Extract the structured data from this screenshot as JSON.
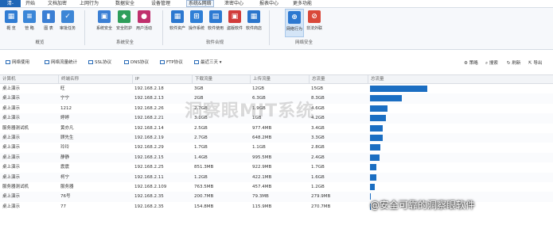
{
  "menubar": {
    "first": "清-",
    "items": [
      "开始",
      "文档加密",
      "上网行为",
      "数据安全",
      "设备管理",
      "系统&网络",
      "泄密中心",
      "报表中心",
      "更多功能"
    ],
    "active_index": 5
  },
  "ribbon": {
    "groups": [
      {
        "title": "概览",
        "buttons": [
          {
            "label": "概 览",
            "icon": "grid-icon",
            "color": "#2f7cd3",
            "glyph": "▦"
          },
          {
            "label": "管 略",
            "icon": "sliders-icon",
            "color": "#3a86d8",
            "glyph": "≡"
          },
          {
            "label": "图 表",
            "icon": "chart-icon",
            "color": "#3b7fd4",
            "glyph": "▮"
          },
          {
            "label": "审批任务",
            "icon": "checklist-icon",
            "color": "#3d86d6",
            "glyph": "✓"
          }
        ]
      },
      {
        "title": "系统安全",
        "buttons": [
          {
            "label": "系统安全",
            "icon": "monitor-shield-icon",
            "color": "#3b7fd4",
            "glyph": "▣"
          },
          {
            "label": "安全防护",
            "icon": "shield-icon",
            "color": "#2e9e5b",
            "glyph": "◆"
          },
          {
            "label": "用户活动",
            "icon": "user-icon",
            "color": "#c0306d",
            "glyph": "●"
          }
        ]
      },
      {
        "title": "软件合规",
        "buttons": [
          {
            "label": "软件资产",
            "icon": "apps-icon",
            "color": "#2c78d0",
            "glyph": "▦"
          },
          {
            "label": "操作系统",
            "icon": "windows-icon",
            "color": "#2f7fd6",
            "glyph": "⊞"
          },
          {
            "label": "软件使用",
            "icon": "software-usage-icon",
            "color": "#2d7ad2",
            "glyph": "▤"
          },
          {
            "label": "盗版软件",
            "icon": "pirate-software-icon",
            "color": "#d13b3b",
            "glyph": "▣"
          },
          {
            "label": "软件商店",
            "icon": "store-icon",
            "color": "#2a75cc",
            "glyph": "▦"
          }
        ]
      },
      {
        "title": "网络安全",
        "buttons": [
          {
            "label": "网络行为",
            "icon": "globe-icon",
            "color": "#2c78d0",
            "glyph": "⊕",
            "selected": true
          },
          {
            "label": "非法外联",
            "icon": "outbound-block-icon",
            "color": "#d9493a",
            "glyph": "⊘"
          }
        ]
      }
    ]
  },
  "toolbar": {
    "tabs": [
      {
        "label": "网络使用",
        "selected": true
      },
      {
        "label": "网络流量统计",
        "selected": false
      },
      {
        "label": "SSL协议",
        "selected": false
      },
      {
        "label": "DNS协议",
        "selected": false
      },
      {
        "label": "FTP协议",
        "selected": false
      }
    ],
    "date_filter": "最近三天",
    "right_buttons": [
      {
        "label": "策略",
        "icon": "policy-icon"
      },
      {
        "label": "搜索",
        "icon": "search-icon"
      },
      {
        "label": "刷新",
        "icon": "refresh-icon"
      },
      {
        "label": "导出",
        "icon": "export-icon"
      }
    ]
  },
  "table": {
    "columns": [
      "计算机",
      "终端名称",
      "IP",
      "下载流量",
      "上传流量",
      "总流量",
      "总流量"
    ],
    "rows": [
      {
        "computer": "桌上演示",
        "terminal": "旺",
        "ip": "192.168.2.18",
        "down": "3GB",
        "up": "12GB",
        "total": "15GB",
        "pct": 1.0
      },
      {
        "computer": "桌上演示",
        "terminal": "宁宁",
        "ip": "192.168.2.13",
        "down": "2GB",
        "up": "6.3GB",
        "total": "8.3GB",
        "pct": 0.553
      },
      {
        "computer": "桌上演示",
        "terminal": "1212",
        "ip": "192.168.2.26",
        "down": "2.7GB",
        "up": "1.9GB",
        "total": "4.6GB",
        "pct": 0.307
      },
      {
        "computer": "桌上演示",
        "terminal": "婷婷",
        "ip": "192.168.2.21",
        "down": "3.1GB",
        "up": "1GB",
        "total": "4.2GB",
        "pct": 0.28
      },
      {
        "computer": "服务器测试机",
        "terminal": "黄亦凡",
        "ip": "192.168.2.14",
        "down": "2.5GB",
        "up": "977.4MB",
        "total": "3.4GB",
        "pct": 0.227
      },
      {
        "computer": "桌上演示",
        "terminal": "顾先生",
        "ip": "192.168.2.19",
        "down": "2.7GB",
        "up": "648.2MB",
        "total": "3.3GB",
        "pct": 0.22
      },
      {
        "computer": "桌上演示",
        "terminal": "玲玲",
        "ip": "192.168.2.29",
        "down": "1.7GB",
        "up": "1.1GB",
        "total": "2.8GB",
        "pct": 0.187
      },
      {
        "computer": "桌上演示",
        "terminal": "静静",
        "ip": "192.168.2.15",
        "down": "1.4GB",
        "up": "995.5MB",
        "total": "2.4GB",
        "pct": 0.16
      },
      {
        "computer": "桌上演示",
        "terminal": "震震",
        "ip": "192.168.2.25",
        "down": "851.3MB",
        "up": "922.9MB",
        "total": "1.7GB",
        "pct": 0.113
      },
      {
        "computer": "桌上演示",
        "terminal": "柯宁",
        "ip": "192.168.2.11",
        "down": "1.2GB",
        "up": "422.1MB",
        "total": "1.6GB",
        "pct": 0.107
      },
      {
        "computer": "服务器测试机",
        "terminal": "服务器",
        "ip": "192.168.2.109",
        "down": "763.5MB",
        "up": "457.4MB",
        "total": "1.2GB",
        "pct": 0.08
      },
      {
        "computer": "桌上演示",
        "terminal": "76号",
        "ip": "192.168.2.35",
        "down": "200.7MB",
        "up": "79.3MB",
        "total": "279.9MB",
        "pct": 0.018
      },
      {
        "computer": "桌上演示",
        "terminal": "77",
        "ip": "192.168.2.35",
        "down": "154.8MB",
        "up": "115.9MB",
        "total": "270.7MB",
        "pct": 0.017
      }
    ]
  },
  "watermark": "洞察眼MIT系统",
  "footer_watermark": "@安全可靠的洞察眼软件",
  "colors": {
    "accent": "#1e66b6",
    "bar": "#1b6ec2"
  }
}
